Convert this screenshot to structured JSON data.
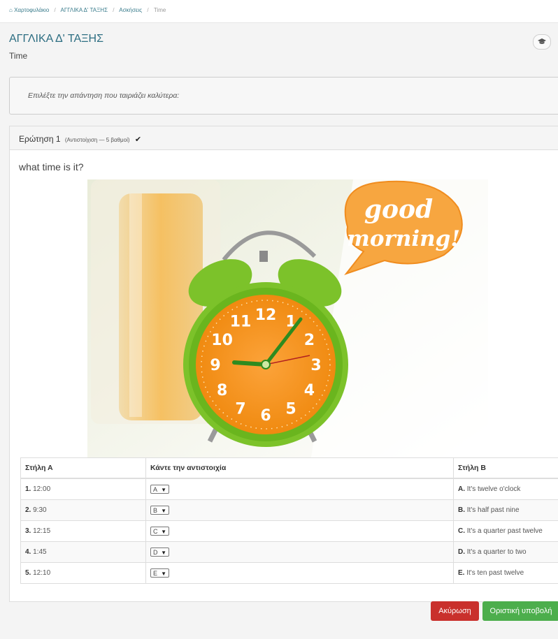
{
  "breadcrumb": {
    "home_icon": "home-icon",
    "items": [
      "Χαρτοφυλάκιο",
      "ΑΓΓΛΙΚΑ Δ' ΤΑΞΗΣ",
      "Ασκήσεις",
      "Time"
    ],
    "separator": "/"
  },
  "header": {
    "title": "ΑΓΓΛΙΚΑ Δ' ΤΑΞΗΣ",
    "subtitle": "Time",
    "tool_icon": "graduation-cap-icon"
  },
  "instructions": {
    "text": "Επιλέξτε την  απάντηση που ταιριάζει καλύτερα:"
  },
  "question": {
    "label": "Ερώτηση 1",
    "meta": "(Αντιστοίχιση — 5 βαθμοί)",
    "check_icon": "checkmark-icon",
    "text": "what time is it?",
    "image": {
      "bubble_text_1": "good",
      "bubble_text_2": "morning!",
      "clock_numbers": [
        "12",
        "1",
        "2",
        "3",
        "4",
        "5",
        "6",
        "7",
        "8",
        "9",
        "10",
        "11"
      ]
    }
  },
  "table": {
    "headers": [
      "Στήλη Α",
      "Κάντε την αντιστοιχία",
      "Στήλη Β"
    ],
    "rows": [
      {
        "num": "1.",
        "a": "12:00",
        "choice": "A",
        "letter": "A.",
        "b": "It's twelve o'clock"
      },
      {
        "num": "2.",
        "a": "9:30",
        "choice": "B",
        "letter": "B.",
        "b": "It's half past nine"
      },
      {
        "num": "3.",
        "a": "12:15",
        "choice": "C",
        "letter": "C.",
        "b": "It's a quarter past twelve"
      },
      {
        "num": "4.",
        "a": "1:45",
        "choice": "D",
        "letter": "D.",
        "b": "It's a quarter to two"
      },
      {
        "num": "5.",
        "a": "12:10",
        "choice": "E",
        "letter": "E.",
        "b": "It's ten past twelve"
      }
    ]
  },
  "buttons": {
    "cancel": "Ακύρωση",
    "submit": "Οριστική υποβολή"
  },
  "colors": {
    "accent": "#2d6e82",
    "cancel": "#c9302c",
    "submit": "#4cae4c",
    "clock_body": "#7cc22a",
    "clock_face": "#f7941d"
  }
}
